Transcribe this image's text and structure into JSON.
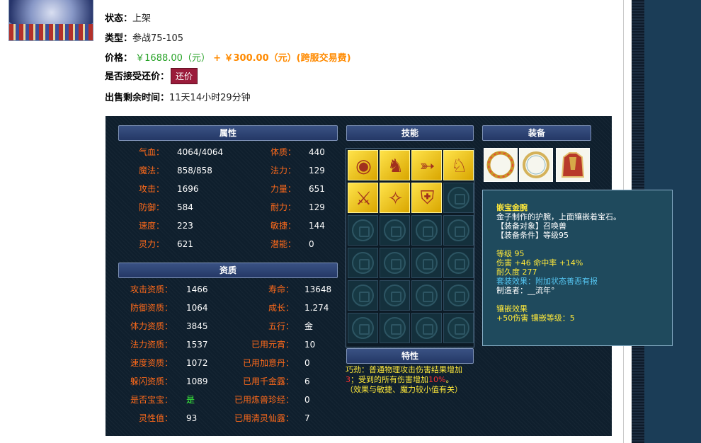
{
  "listing": {
    "status_label": "状态：",
    "status_value": "上架",
    "type_label": "类型：",
    "type_value": "参战75-105",
    "price_label": "价格：",
    "price_main": "￥1688.00（元）",
    "price_plus": "+ ￥300.00（元）(跨服交易费)",
    "haggle_label": "是否接受还价：",
    "haggle_button": "还价",
    "time_label": "出售剩余时间：",
    "time_value": "11天14小时29分钟"
  },
  "headers": {
    "attributes": "属性",
    "skills": "技能",
    "equipment": "装备",
    "aptitude": "资质",
    "traits": "特性"
  },
  "attributes": [
    {
      "l1": "气血：",
      "v1": "4064/4064",
      "l2": "体质：",
      "v2": "440"
    },
    {
      "l1": "魔法：",
      "v1": "858/858",
      "l2": "法力：",
      "v2": "129"
    },
    {
      "l1": "攻击：",
      "v1": "1696",
      "l2": "力量：",
      "v2": "651"
    },
    {
      "l1": "防御：",
      "v1": "584",
      "l2": "耐力：",
      "v2": "129"
    },
    {
      "l1": "速度：",
      "v1": "223",
      "l2": "敏捷：",
      "v2": "144"
    },
    {
      "l1": "灵力：",
      "v1": "621",
      "l2": "潜能：",
      "v2": "0"
    }
  ],
  "aptitude": [
    {
      "l1": "攻击资质：",
      "v1": "1466",
      "l2": "寿命：",
      "v2": "13648"
    },
    {
      "l1": "防御资质：",
      "v1": "1064",
      "l2": "成长：",
      "v2": "1.274"
    },
    {
      "l1": "体力资质：",
      "v1": "3845",
      "l2": "五行：",
      "v2": "金"
    },
    {
      "l1": "法力资质：",
      "v1": "1537",
      "l2": "已用元宵：",
      "v2": "10"
    },
    {
      "l1": "速度资质：",
      "v1": "1072",
      "l2": "已用加意丹：",
      "v2": "0"
    },
    {
      "l1": "躲闪资质：",
      "v1": "1089",
      "l2": "已用千金露：",
      "v2": "6"
    },
    {
      "l1": "是否宝宝：",
      "v1": "是",
      "l2": "已用炼兽珍经：",
      "v2": "0"
    },
    {
      "l1": "灵性值：",
      "v1": "93",
      "l2": "已用清灵仙露：",
      "v2": "7"
    }
  ],
  "colors": {
    "label": "#ff6a1a",
    "value": "#ffffff",
    "baby": "#3cff3c",
    "accent": "#ffe93a"
  },
  "skills": [
    "eye-skill-icon",
    "kneel-skill-icon",
    "bow-skill-icon",
    "beast-skill-icon",
    "swords-skill-icon",
    "sword-skill-icon",
    "shield-skill-icon"
  ],
  "trait": {
    "p1": "巧劲：普通物理攻击伤害结果增加",
    "p1_num": "3",
    "p2": "；受到的所有伤害增加",
    "p2_num": "10%",
    "p3": "。",
    "p4": "（效果与敏捷、魔力较小值有关）"
  },
  "tooltip": {
    "name": "嵌宝金腕",
    "desc": "金子制作的护腕，上面镶嵌着宝石。",
    "target": "【装备对象】召唤兽",
    "req": "【装备条件】等级95",
    "level": "等级 95",
    "stats": "伤害 +46 命中率 +14%",
    "durability": "耐久度 277",
    "set": "套装效果：附加状态善恶有报",
    "maker": "制造者：__流年°",
    "inlay_title": "镶嵌效果",
    "inlay": "+50伤害 镶嵌等级：5"
  }
}
